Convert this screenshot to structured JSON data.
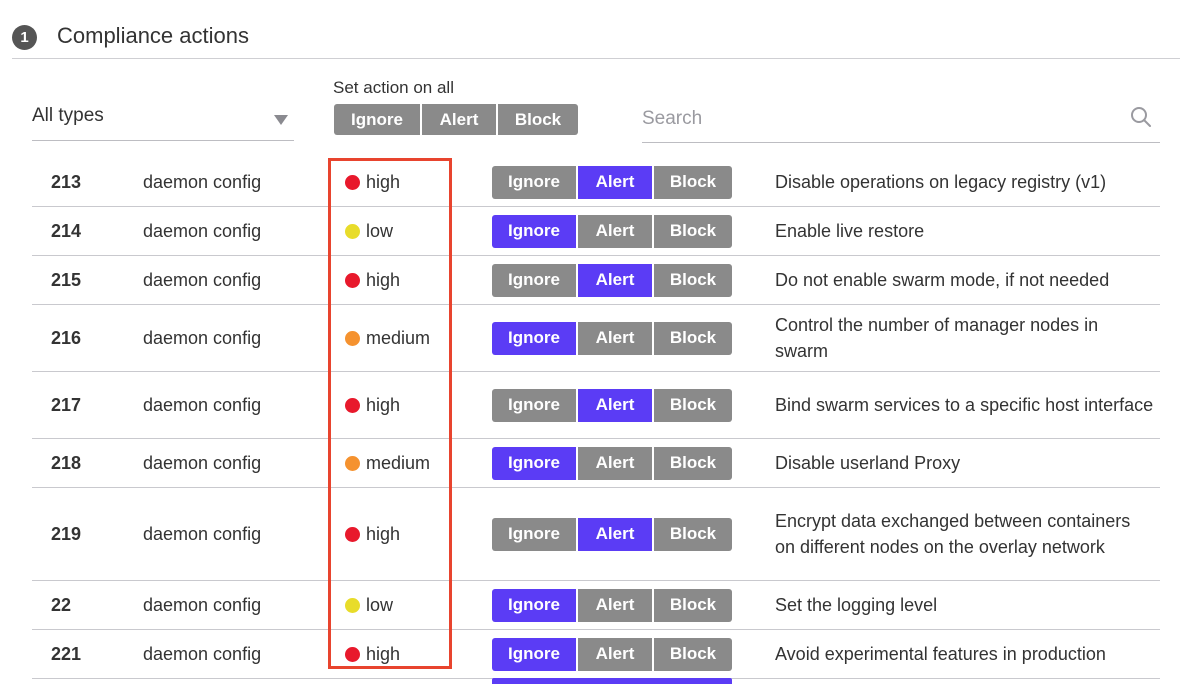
{
  "section": {
    "step": "1",
    "title": "Compliance actions"
  },
  "filter": {
    "selected": "All types"
  },
  "set_all": {
    "label": "Set action on all",
    "buttons": [
      "Ignore",
      "Alert",
      "Block"
    ]
  },
  "search": {
    "placeholder": "Search"
  },
  "colors": {
    "active": "#5b3cf5",
    "inactive": "#8a8a8a",
    "high": "#e8192c",
    "medium": "#f5922f",
    "low": "#e8dc2a",
    "highlight": "#e8442e"
  },
  "rows": [
    {
      "id": "213",
      "type": "daemon config",
      "severity": "high",
      "action": "Alert",
      "description": "Disable operations on legacy registry (v1)"
    },
    {
      "id": "214",
      "type": "daemon config",
      "severity": "low",
      "action": "Ignore",
      "description": "Enable live restore"
    },
    {
      "id": "215",
      "type": "daemon config",
      "severity": "high",
      "action": "Alert",
      "description": "Do not enable swarm mode, if not needed"
    },
    {
      "id": "216",
      "type": "daemon config",
      "severity": "medium",
      "action": "Ignore",
      "description": "Control the number of manager nodes in swarm"
    },
    {
      "id": "217",
      "type": "daemon config",
      "severity": "high",
      "action": "Alert",
      "description": "Bind swarm services to a specific host interface"
    },
    {
      "id": "218",
      "type": "daemon config",
      "severity": "medium",
      "action": "Ignore",
      "description": "Disable userland Proxy"
    },
    {
      "id": "219",
      "type": "daemon config",
      "severity": "high",
      "action": "Alert",
      "description": "Encrypt data exchanged between containers on different nodes on the overlay network"
    },
    {
      "id": "22",
      "type": "daemon config",
      "severity": "low",
      "action": "Ignore",
      "description": "Set the logging level"
    },
    {
      "id": "221",
      "type": "daemon config",
      "severity": "high",
      "action": "Ignore",
      "description": "Avoid experimental features in production"
    }
  ],
  "action_options": [
    "Ignore",
    "Alert",
    "Block"
  ]
}
